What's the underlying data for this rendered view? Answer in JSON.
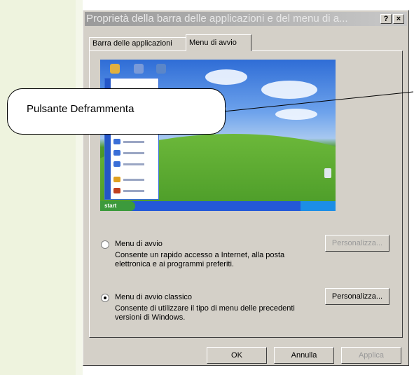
{
  "dialog": {
    "title": "Proprietà della barra delle applicazioni e del menu di a...",
    "help_button": "?",
    "close_button": "×"
  },
  "tabs": [
    {
      "label": "Barra delle applicazioni"
    },
    {
      "label": "Menu di avvio"
    }
  ],
  "preview": {
    "start_label": "start"
  },
  "callout": {
    "text": "Pulsante Deframmenta"
  },
  "options": [
    {
      "label": "Menu di avvio",
      "description": "Consente un rapido accesso a Internet, alla posta elettronica e ai programmi preferiti.",
      "selected": false,
      "customize_label": "Personalizza...",
      "customize_enabled": false
    },
    {
      "label": "Menu di avvio classico",
      "description": "Consente di utilizzare il tipo di menu delle precedenti versioni di Windows.",
      "selected": true,
      "customize_label": "Personalizza...",
      "customize_enabled": true
    }
  ],
  "footer": {
    "ok_label": "OK",
    "cancel_label": "Annulla",
    "apply_label": "Applica"
  }
}
